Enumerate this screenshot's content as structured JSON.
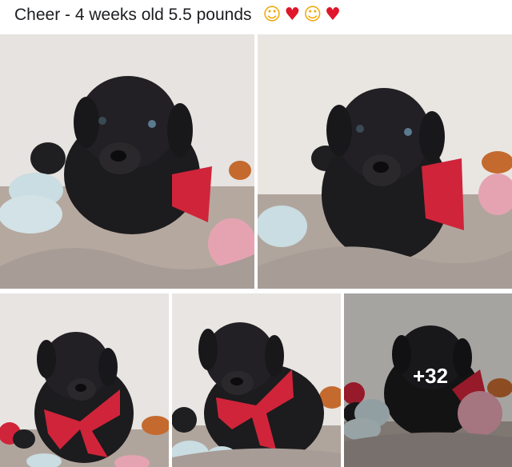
{
  "post": {
    "caption": "Cheer - 4 weeks old 5.5 pounds",
    "emojis": [
      {
        "icon": "smiling-face-with-hearts-emoji",
        "glyph": "☺",
        "kind": "smile"
      },
      {
        "icon": "red-heart-emoji",
        "glyph": "♥",
        "kind": "heart"
      },
      {
        "icon": "smiling-face-with-hearts-emoji",
        "glyph": "☺",
        "kind": "smile"
      },
      {
        "icon": "red-heart-emoji",
        "glyph": "♥",
        "kind": "heart"
      }
    ]
  },
  "gallery": {
    "photos": [
      {
        "subject": "black-lab-puppy-with-red-bow"
      },
      {
        "subject": "black-lab-puppy-with-red-bow"
      },
      {
        "subject": "black-lab-puppy-with-red-bow"
      },
      {
        "subject": "black-lab-puppy-with-red-bow"
      },
      {
        "subject": "black-lab-puppy-with-red-bow"
      }
    ],
    "more_count": "+32"
  },
  "colors": {
    "bow_red": "#d0243a",
    "puppy_black": "#1c1b1d",
    "blanket": "#a79c96",
    "pumpkin_pink": "#e5a3b2",
    "pumpkin_blue": "#c9dde2"
  }
}
